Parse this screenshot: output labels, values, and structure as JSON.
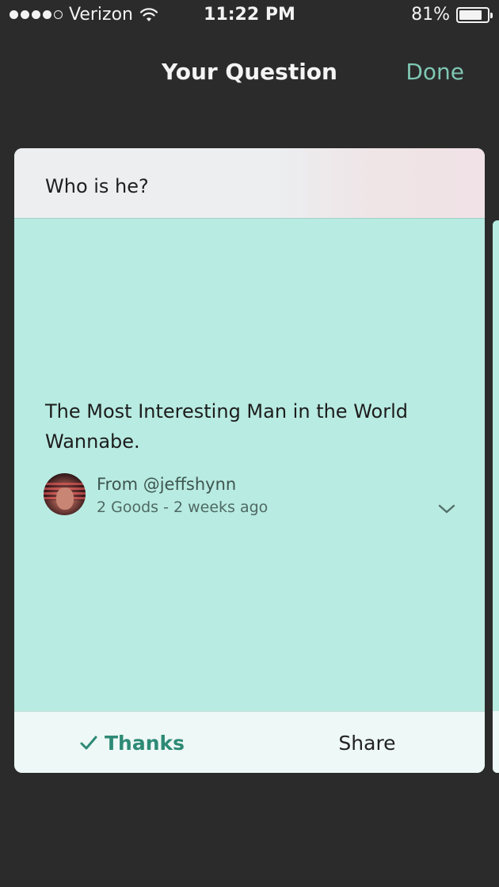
{
  "status_bar": {
    "carrier": "Verizon",
    "time": "11:22 PM",
    "battery_percent": "81%",
    "battery_level": 0.81,
    "signal_bars_filled": 4,
    "signal_bars_total": 5
  },
  "nav": {
    "title": "Your Question",
    "done_label": "Done"
  },
  "question": {
    "text": "Who is he?"
  },
  "answer": {
    "text": "The Most Interesting Man in the World Wannabe.",
    "author": "From @jeffshynn",
    "meta": "2 Goods - 2 weeks ago"
  },
  "actions": {
    "thanks_label": "Thanks",
    "share_label": "Share"
  },
  "colors": {
    "background": "#2b2b2b",
    "accent": "#7fc7b3",
    "card_answer_bg": "#b8ebe1",
    "thanks_color": "#2d8a75"
  },
  "icons": [
    "wifi-icon",
    "battery-icon",
    "chevron-down-icon",
    "check-icon",
    "avatar"
  ]
}
